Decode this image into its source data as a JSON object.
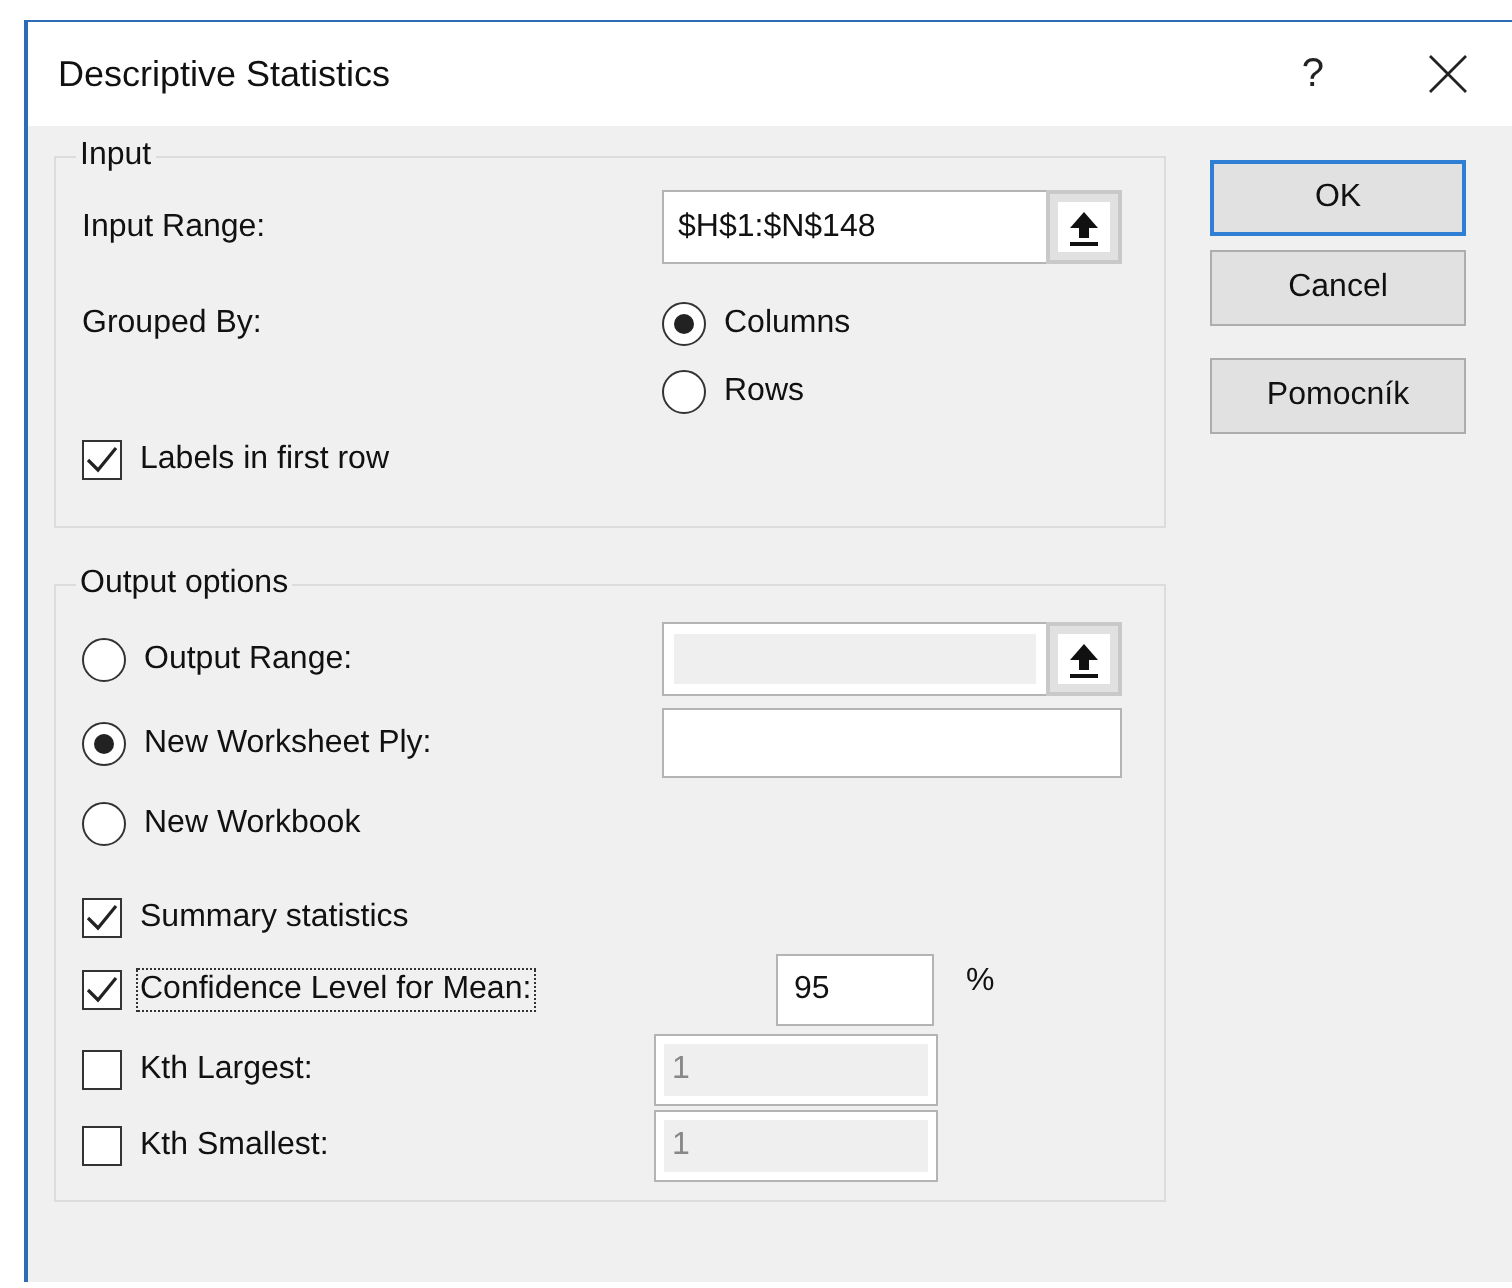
{
  "window": {
    "title": "Descriptive Statistics",
    "help": "?"
  },
  "input": {
    "legend": "Input",
    "range": {
      "label": "Input Range:",
      "value": "$H$1:$N$148"
    },
    "grouped_by": {
      "label": "Grouped By:",
      "options": [
        {
          "label": "Columns",
          "selected": true
        },
        {
          "label": "Rows",
          "selected": false
        }
      ]
    },
    "labels_in_first_row": {
      "label": "Labels in first row",
      "checked": true
    }
  },
  "output": {
    "legend": "Output options",
    "destinations": [
      {
        "kind": "range",
        "label": "Output Range:",
        "selected": false,
        "field_disabled": true
      },
      {
        "kind": "text",
        "label": "New Worksheet Ply:",
        "selected": true,
        "field_disabled": false
      },
      {
        "kind": "plain",
        "label": "New Workbook",
        "selected": false
      }
    ],
    "options": [
      {
        "kind": "plain",
        "label": "Summary statistics",
        "checked": true,
        "focused": false
      },
      {
        "kind": "percent",
        "label": "Confidence Level for Mean:",
        "checked": true,
        "focused": true,
        "value": "95",
        "unit": "%",
        "value_disabled": false
      },
      {
        "kind": "number",
        "label": "Kth Largest:",
        "checked": false,
        "focused": false,
        "value": "1",
        "value_disabled": true
      },
      {
        "kind": "number",
        "label": "Kth Smallest:",
        "checked": false,
        "focused": false,
        "value": "1",
        "value_disabled": true
      }
    ]
  },
  "buttons": [
    {
      "label": "OK",
      "default": true
    },
    {
      "label": "Cancel",
      "default": false
    },
    {
      "label": "Pomocník",
      "default": false
    }
  ]
}
